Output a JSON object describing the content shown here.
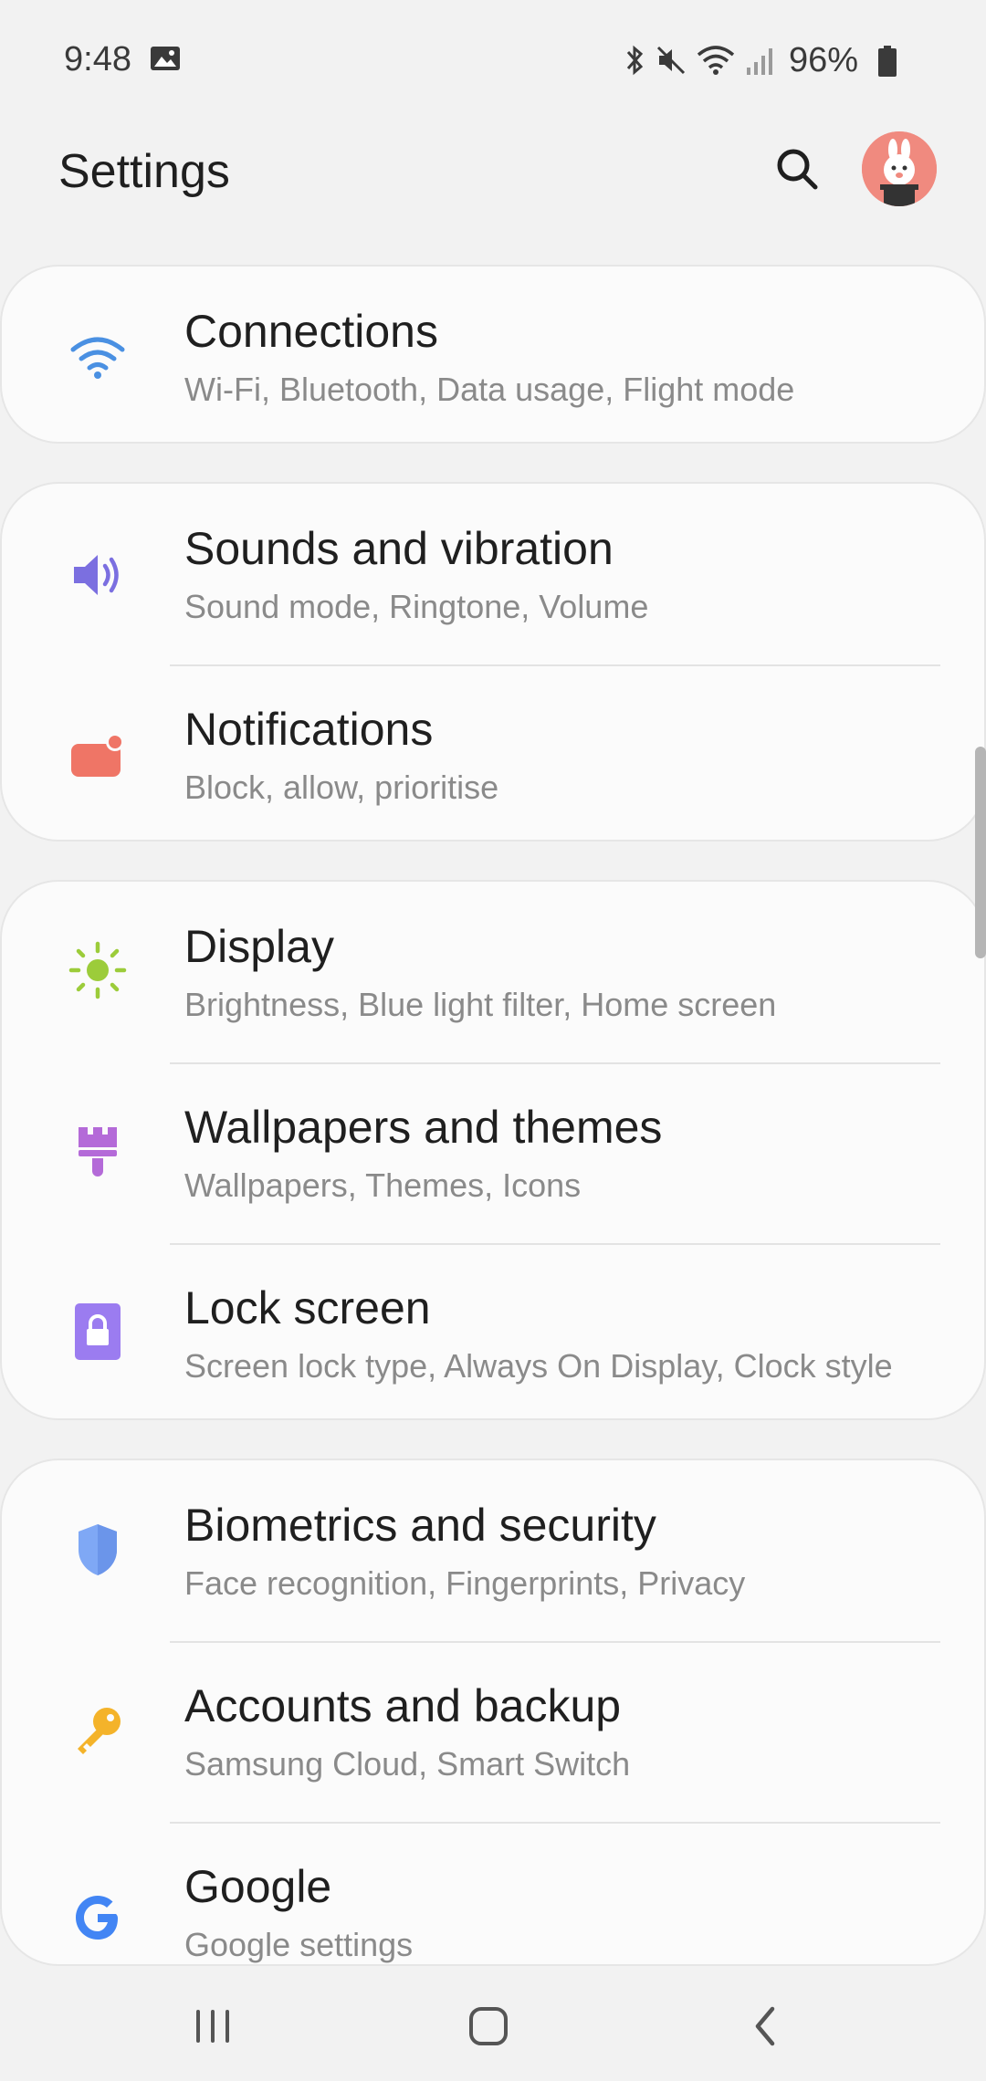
{
  "status_bar": {
    "time": "9:48",
    "battery_percent": "96%",
    "icons": [
      "gallery-icon",
      "bluetooth-icon",
      "mute-icon",
      "wifi-icon",
      "signal-icon",
      "battery-icon"
    ]
  },
  "header": {
    "title": "Settings",
    "search_icon": "search-icon",
    "avatar": "profile-avatar"
  },
  "groups": [
    {
      "items": [
        {
          "title": "Connections",
          "subtitle": "Wi-Fi, Bluetooth, Data usage, Flight mode",
          "icon": "wifi-icon",
          "color": "#4a90e2"
        }
      ]
    },
    {
      "items": [
        {
          "title": "Sounds and vibration",
          "subtitle": "Sound mode, Ringtone, Volume",
          "icon": "speaker-icon",
          "color": "#7b6fe0"
        },
        {
          "title": "Notifications",
          "subtitle": "Block, allow, prioritise",
          "icon": "notification-icon",
          "color": "#ef7566"
        }
      ]
    },
    {
      "items": [
        {
          "title": "Display",
          "subtitle": "Brightness, Blue light filter, Home screen",
          "icon": "brightness-icon",
          "color": "#9ccc3a"
        },
        {
          "title": "Wallpapers and themes",
          "subtitle": "Wallpapers, Themes, Icons",
          "icon": "paintbrush-icon",
          "color": "#b46ad8"
        },
        {
          "title": "Lock screen",
          "subtitle": "Screen lock type, Always On Display, Clock style",
          "icon": "lock-icon",
          "color": "#9b7cf0"
        }
      ]
    },
    {
      "items": [
        {
          "title": "Biometrics and security",
          "subtitle": "Face recognition, Fingerprints, Privacy",
          "icon": "shield-icon",
          "color": "#7fa8f5"
        },
        {
          "title": "Accounts and backup",
          "subtitle": "Samsung Cloud, Smart Switch",
          "icon": "key-icon",
          "color": "#f4b32a"
        },
        {
          "title": "Google",
          "subtitle": "Google settings",
          "icon": "google-icon",
          "color": "#4285f4"
        }
      ]
    }
  ],
  "nav_bar": {
    "recents": "recents-icon",
    "home": "home-icon",
    "back": "back-icon"
  }
}
